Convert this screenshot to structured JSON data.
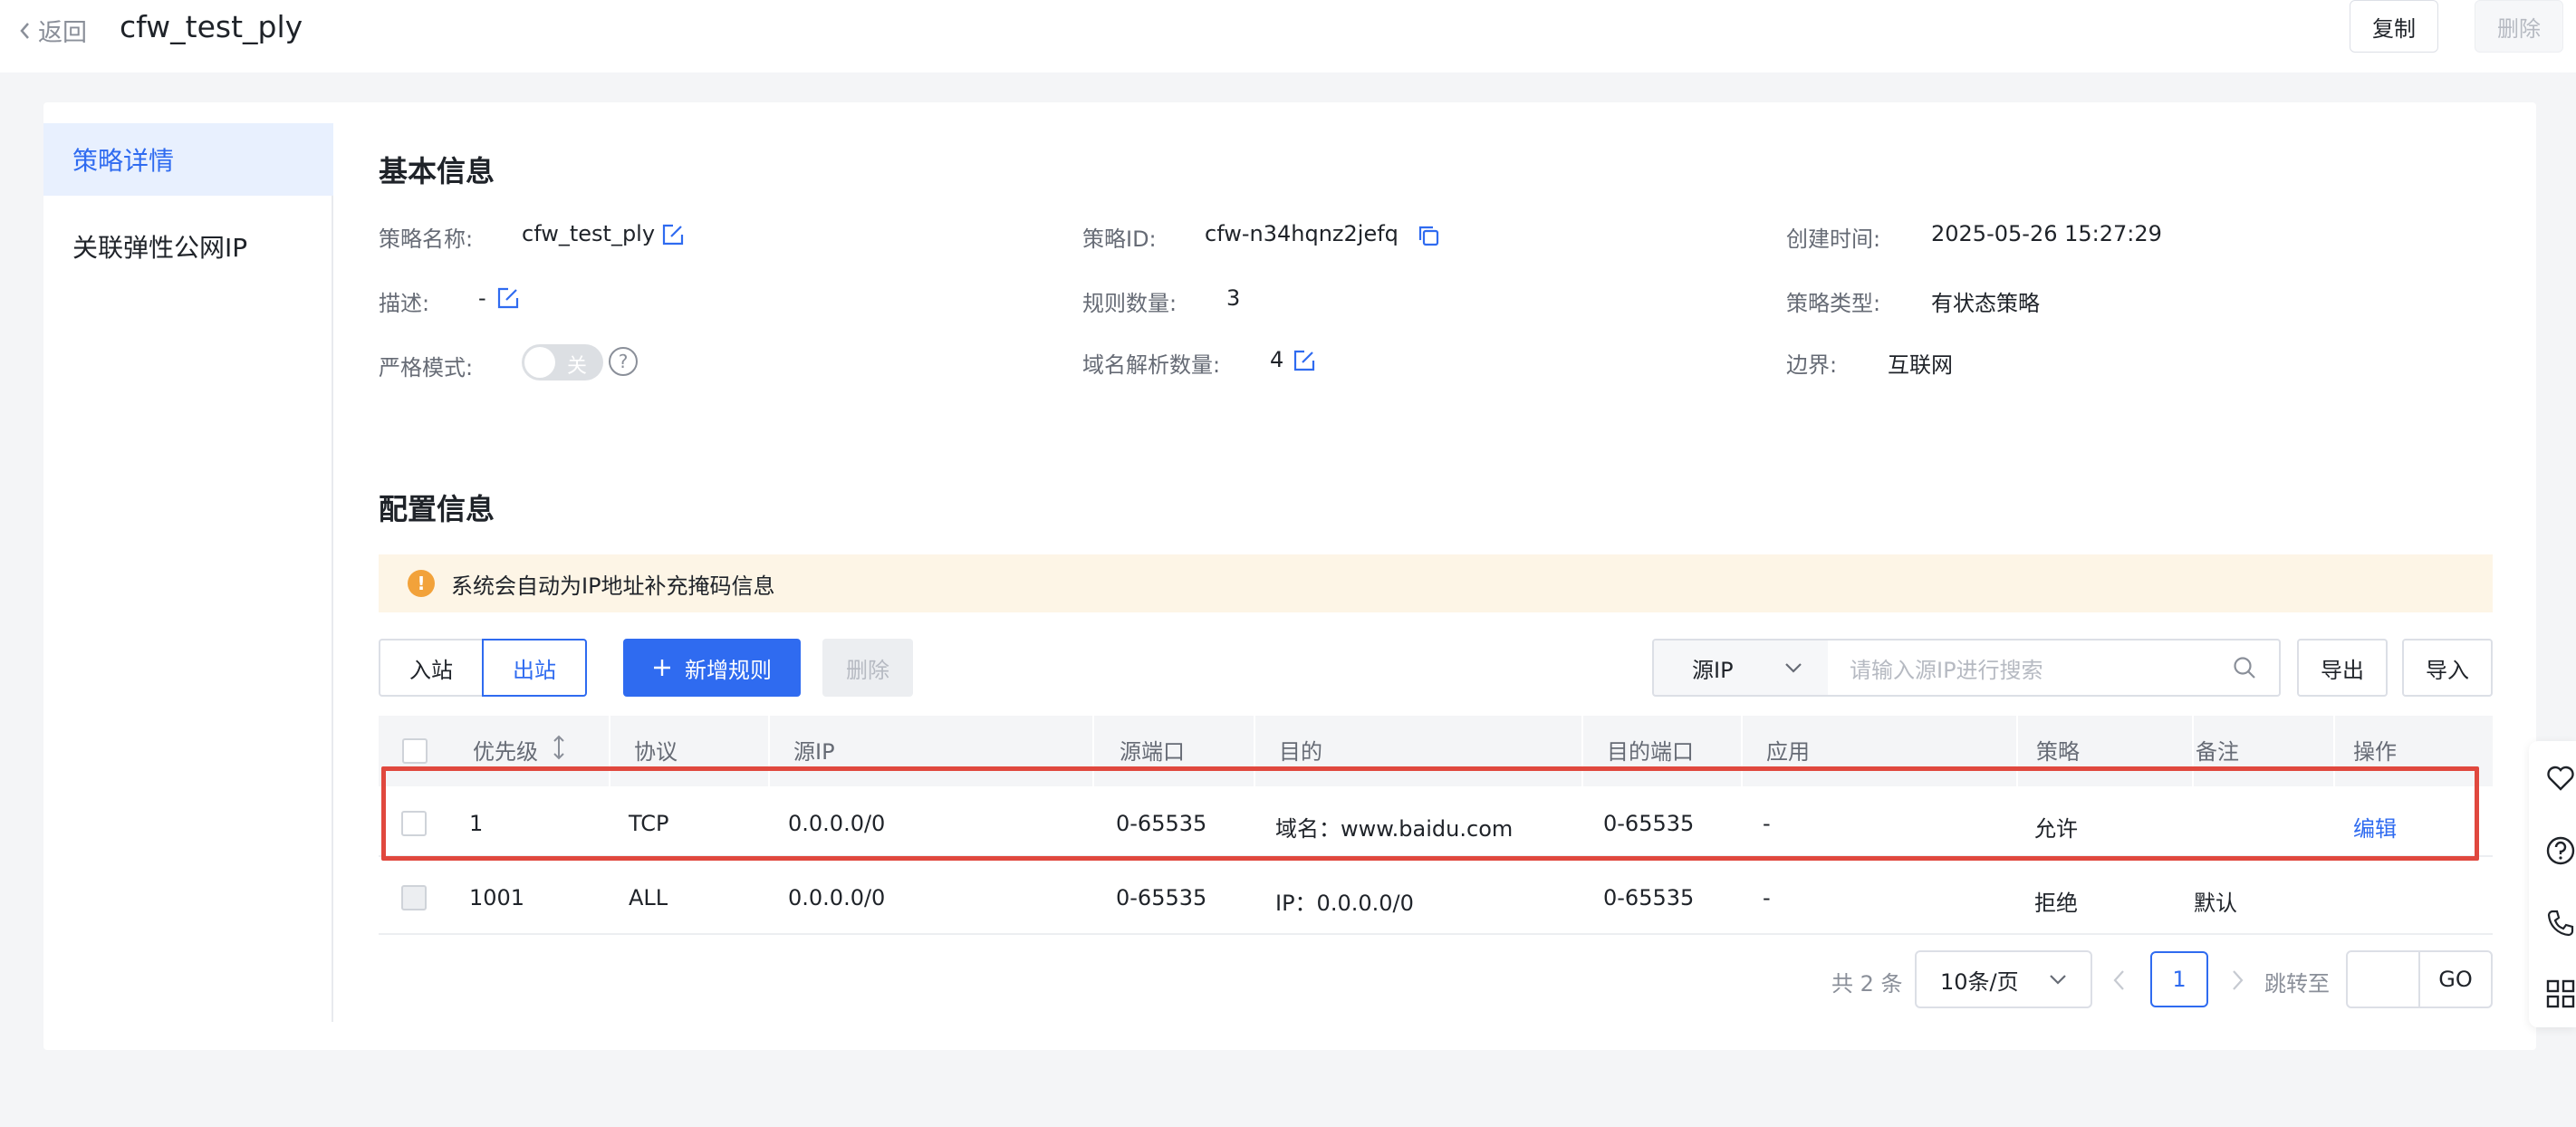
{
  "header": {
    "back_label": "返回",
    "title": "cfw_test_ply",
    "copy_label": "复制",
    "delete_label": "删除"
  },
  "sidebar": {
    "items": [
      {
        "label": "策略详情",
        "active": true
      },
      {
        "label": "关联弹性公网IP",
        "active": false
      }
    ]
  },
  "basic": {
    "title": "基本信息",
    "name_label": "策略名称:",
    "name_value": "cfw_test_ply",
    "desc_label": "描述:",
    "desc_value": "-",
    "strict_label": "严格模式:",
    "strict_toggle": "关",
    "id_label": "策略ID:",
    "id_value": "cfw-n34hqnz2jefq",
    "rule_count_label": "规则数量:",
    "rule_count_value": "3",
    "domain_count_label": "域名解析数量:",
    "domain_count_value": "4",
    "created_label": "创建时间:",
    "created_value": "2025-05-26 15:27:29",
    "type_label": "策略类型:",
    "type_value": "有状态策略",
    "boundary_label": "边界:",
    "boundary_value": "互联网"
  },
  "config": {
    "title": "配置信息",
    "notice": "系统会自动为IP地址补充掩码信息",
    "tab_in": "入站",
    "tab_out": "出站",
    "add_label": "新增规则",
    "delete_label": "删除",
    "filter_select": "源IP",
    "search_placeholder": "请输入源IP进行搜索",
    "export_label": "导出",
    "import_label": "导入"
  },
  "table": {
    "columns": [
      "优先级",
      "协议",
      "源IP",
      "源端口",
      "目的",
      "目的端口",
      "应用",
      "策略",
      "备注",
      "操作"
    ],
    "rows": [
      {
        "priority": "1",
        "protocol": "TCP",
        "src_ip": "0.0.0.0/0",
        "src_port": "0-65535",
        "dest": "域名：www.baidu.com",
        "dest_port": "0-65535",
        "app": "-",
        "policy": "允许",
        "remark": "",
        "action": "编辑"
      },
      {
        "priority": "1001",
        "protocol": "ALL",
        "src_ip": "0.0.0.0/0",
        "src_port": "0-65535",
        "dest": "IP：0.0.0.0/0",
        "dest_port": "0-65535",
        "app": "-",
        "policy": "拒绝",
        "remark": "默认",
        "action": ""
      }
    ]
  },
  "pagination": {
    "total": "共 2 条",
    "page_size": "10条/页",
    "current_page": "1",
    "jump_label": "跳转至",
    "go_label": "GO"
  },
  "colors": {
    "accent": "#2f6bf0",
    "highlight_border": "#e0483e",
    "notice_bg": "#fdf5e6",
    "warning_icon": "#f2a23a"
  },
  "icons": [
    "chevron-left-icon",
    "edit-icon",
    "copy-icon",
    "help-icon",
    "warning-icon",
    "plus-icon",
    "chevron-down-icon",
    "search-icon",
    "sort-icon",
    "heart-icon",
    "phone-icon",
    "grid-icon"
  ]
}
